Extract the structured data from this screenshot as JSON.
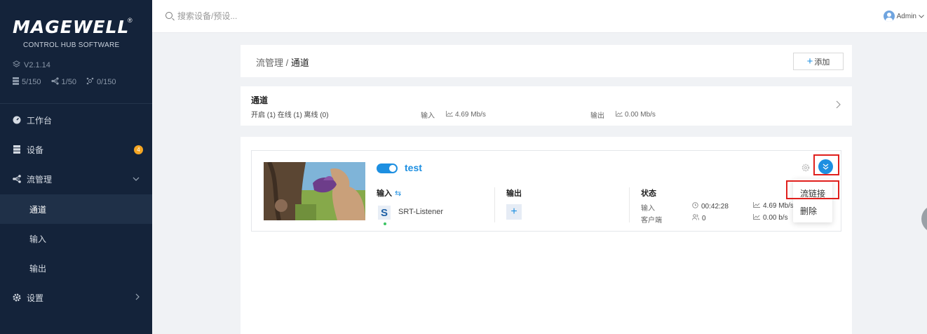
{
  "sidebar": {
    "logo": "MAGEWELL",
    "logo_mark": "®",
    "subtitle": "CONTROL HUB SOFTWARE",
    "version": "V2.1.14",
    "stats": [
      {
        "icon": "server-icon",
        "value": "5/150"
      },
      {
        "icon": "network-icon",
        "value": "1/50"
      },
      {
        "icon": "share-icon",
        "value": "0/150"
      }
    ],
    "nav": {
      "dashboard": "工作台",
      "devices": "设备",
      "devices_badge": "4",
      "stream_mgmt": "流管理",
      "channels": "通道",
      "input": "输入",
      "output": "输出",
      "settings": "设置"
    }
  },
  "topbar": {
    "search_placeholder": "搜索设备/预设...",
    "user": "Admin"
  },
  "breadcrumb": {
    "parent": "流管理",
    "separator": "/",
    "current": "通道",
    "add_label": "添加"
  },
  "summary": {
    "title": "通道",
    "counts": "开启 (1)  在线 (1)  离线 (0)",
    "input_label": "输入",
    "input_rate": "4.69 Mb/s",
    "output_label": "输出",
    "output_rate": "0.00 Mb/s"
  },
  "channel": {
    "name": "test",
    "enabled": true,
    "input_title": "输入",
    "input_name": "SRT-Listener",
    "output_title": "输出",
    "status_title": "状态",
    "status": {
      "input_label": "输入",
      "input_time": "00:42:28",
      "input_rate": "4.69 Mb/s",
      "client_label": "客户端",
      "client_count": "0",
      "client_rate": "0.00 b/s"
    }
  },
  "dropdown": {
    "items": [
      "流链接",
      "删除"
    ]
  },
  "colors": {
    "sidebar_bg": "#14233a",
    "accent": "#1d8fe1",
    "highlight": "#e0201d",
    "badge": "#f5a623"
  }
}
